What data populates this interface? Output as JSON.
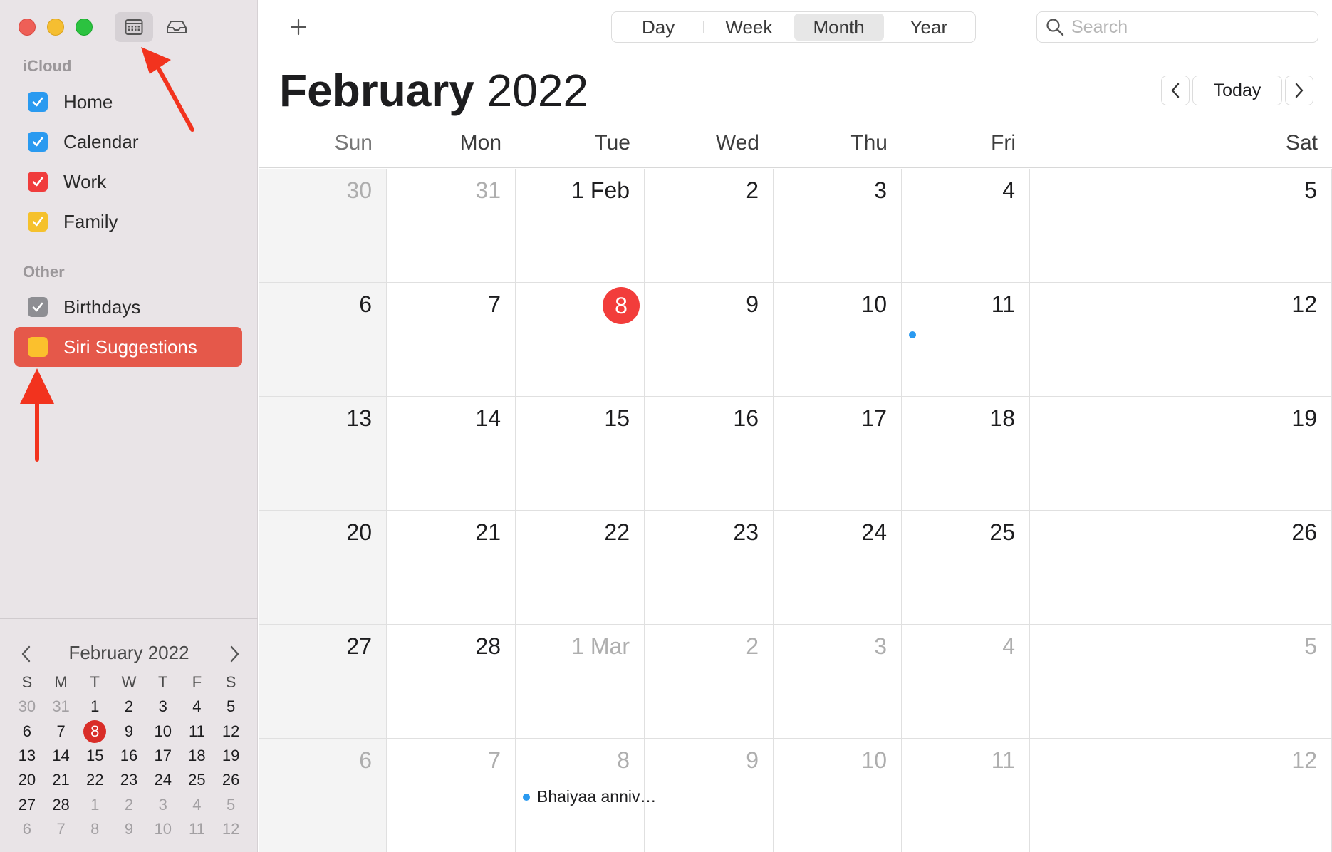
{
  "sidebar": {
    "sections": [
      {
        "title": "iCloud",
        "items": [
          {
            "label": "Home",
            "color": "#2a9af0",
            "checked": true
          },
          {
            "label": "Calendar",
            "color": "#2a9af0",
            "checked": true
          },
          {
            "label": "Work",
            "color": "#f03c3c",
            "checked": true
          },
          {
            "label": "Family",
            "color": "#f5c12c",
            "checked": true
          }
        ]
      },
      {
        "title": "Other",
        "items": [
          {
            "label": "Birthdays",
            "color": "#8e8e93",
            "checked": true
          },
          {
            "label": "Siri Suggestions",
            "color": "#fbc02d",
            "checked": false,
            "selected": true
          }
        ]
      }
    ]
  },
  "mini_calendar": {
    "title": "February 2022",
    "weekday_heads": [
      "S",
      "M",
      "T",
      "W",
      "T",
      "F",
      "S"
    ],
    "weeks": [
      [
        "30",
        "31",
        "1",
        "2",
        "3",
        "4",
        "5"
      ],
      [
        "6",
        "7",
        "8",
        "9",
        "10",
        "11",
        "12"
      ],
      [
        "13",
        "14",
        "15",
        "16",
        "17",
        "18",
        "19"
      ],
      [
        "20",
        "21",
        "22",
        "23",
        "24",
        "25",
        "26"
      ],
      [
        "27",
        "28",
        "1",
        "2",
        "3",
        "4",
        "5"
      ],
      [
        "6",
        "7",
        "8",
        "9",
        "10",
        "11",
        "12"
      ]
    ],
    "today": "8"
  },
  "toolbar": {
    "views": [
      "Day",
      "Week",
      "Month",
      "Year"
    ],
    "active_view": "Month",
    "search_placeholder": "Search"
  },
  "header": {
    "month": "February",
    "year": "2022",
    "today_label": "Today"
  },
  "weekdays": [
    "Sun",
    "Mon",
    "Tue",
    "Wed",
    "Thu",
    "Fri",
    "Sat"
  ],
  "month_grid": [
    [
      {
        "d": "30",
        "dim": true
      },
      {
        "d": "31",
        "dim": true
      },
      {
        "d": "1 Feb"
      },
      {
        "d": "2"
      },
      {
        "d": "3"
      },
      {
        "d": "4"
      },
      {
        "d": "5"
      }
    ],
    [
      {
        "d": "6"
      },
      {
        "d": "7"
      },
      {
        "d": "8",
        "today": true
      },
      {
        "d": "9"
      },
      {
        "d": "10"
      },
      {
        "d": "11",
        "event": ""
      },
      {
        "d": "12"
      }
    ],
    [
      {
        "d": "13"
      },
      {
        "d": "14"
      },
      {
        "d": "15"
      },
      {
        "d": "16"
      },
      {
        "d": "17"
      },
      {
        "d": "18"
      },
      {
        "d": "19"
      }
    ],
    [
      {
        "d": "20"
      },
      {
        "d": "21"
      },
      {
        "d": "22"
      },
      {
        "d": "23"
      },
      {
        "d": "24"
      },
      {
        "d": "25"
      },
      {
        "d": "26"
      }
    ],
    [
      {
        "d": "27"
      },
      {
        "d": "28"
      },
      {
        "d": "1 Mar",
        "dim": true
      },
      {
        "d": "2",
        "dim": true
      },
      {
        "d": "3",
        "dim": true
      },
      {
        "d": "4",
        "dim": true
      },
      {
        "d": "5",
        "dim": true
      }
    ],
    [
      {
        "d": "6",
        "dim": true
      },
      {
        "d": "7",
        "dim": true
      },
      {
        "d": "8",
        "dim": true,
        "event": "Bhaiyaa anniv…"
      },
      {
        "d": "9",
        "dim": true
      },
      {
        "d": "10",
        "dim": true
      },
      {
        "d": "11",
        "dim": true
      },
      {
        "d": "12",
        "dim": true
      }
    ]
  ],
  "colors": {
    "accent_red": "#e5584a",
    "today_red": "#f23d3b",
    "event_blue": "#2a9af0",
    "arrow_red": "#f2331e"
  }
}
